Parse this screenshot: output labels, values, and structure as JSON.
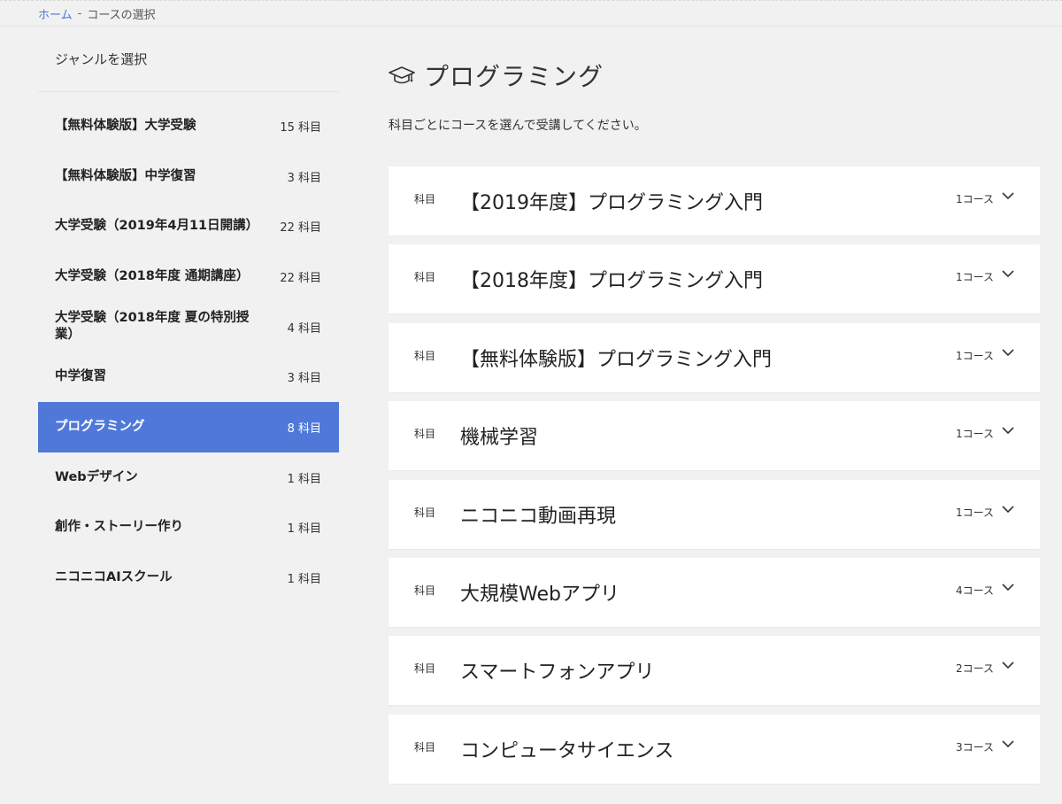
{
  "breadcrumb": {
    "home": "ホーム",
    "separator": "-",
    "current": "コースの選択"
  },
  "sidebar": {
    "heading": "ジャンルを選択",
    "items": [
      {
        "label": "【無料体験版】大学受験",
        "count": "15 科目",
        "active": false
      },
      {
        "label": "【無料体験版】中学復習",
        "count": "3 科目",
        "active": false
      },
      {
        "label": "大学受験（2019年4月11日開講）",
        "count": "22 科目",
        "active": false
      },
      {
        "label": "大学受験（2018年度 通期講座）",
        "count": "22 科目",
        "active": false
      },
      {
        "label": "大学受験（2018年度 夏の特別授業）",
        "count": "4 科目",
        "active": false
      },
      {
        "label": "中学復習",
        "count": "3 科目",
        "active": false
      },
      {
        "label": "プログラミング",
        "count": "8 科目",
        "active": true
      },
      {
        "label": "Webデザイン",
        "count": "1 科目",
        "active": false
      },
      {
        "label": "創作・ストーリー作り",
        "count": "1 科目",
        "active": false
      },
      {
        "label": "ニコニコAIスクール",
        "count": "1 科目",
        "active": false
      }
    ]
  },
  "main": {
    "title": "プログラミング",
    "title_icon": "graduation-cap-icon",
    "lead": "科目ごとにコースを選んで受講してください。",
    "subjects": [
      {
        "tag": "科目",
        "title": "【2019年度】プログラミング入門",
        "count": "1コース"
      },
      {
        "tag": "科目",
        "title": "【2018年度】プログラミング入門",
        "count": "1コース"
      },
      {
        "tag": "科目",
        "title": "【無料体験版】プログラミング入門",
        "count": "1コース"
      },
      {
        "tag": "科目",
        "title": "機械学習",
        "count": "1コース"
      },
      {
        "tag": "科目",
        "title": "ニコニコ動画再現",
        "count": "1コース"
      },
      {
        "tag": "科目",
        "title": "大規模Webアプリ",
        "count": "4コース"
      },
      {
        "tag": "科目",
        "title": "スマートフォンアプリ",
        "count": "2コース"
      },
      {
        "tag": "科目",
        "title": "コンピュータサイエンス",
        "count": "3コース"
      }
    ]
  },
  "colors": {
    "accent": "#4f78d9",
    "link": "#4a74d8",
    "background": "#f1f1f1",
    "card": "#ffffff"
  }
}
